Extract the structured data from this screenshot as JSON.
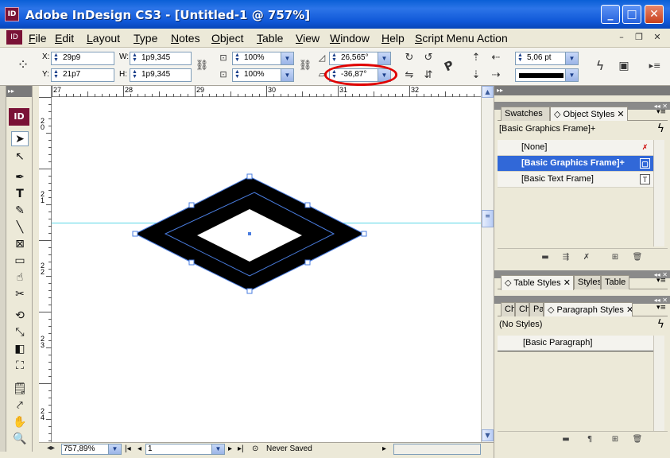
{
  "titlebar": {
    "title": "Adobe InDesign CS3 - [Untitled-1 @ 757%]",
    "app_icon": "ID"
  },
  "menu": [
    "File",
    "Edit",
    "Layout",
    "Type",
    "Notes",
    "Object",
    "Table",
    "View",
    "Window",
    "Help",
    "Script Menu Action"
  ],
  "control": {
    "x_label": "X:",
    "x_value": "29p9",
    "y_label": "Y:",
    "y_value": "21p7",
    "w_label": "W:",
    "w_value": "1p9,345",
    "h_label": "H:",
    "h_value": "1p9,345",
    "scale_x": "100%",
    "scale_y": "100%",
    "rotation": "26,565°",
    "shear": "-36,87°",
    "stroke_weight": "5,06 pt",
    "p_label": "P",
    "highlight_color": "#e00000"
  },
  "ruler": {
    "h_ticks": [
      "27",
      "28",
      "29",
      "30",
      "31",
      "32"
    ],
    "v_ticks": [
      "2\n0",
      "2\n1",
      "2\n2",
      "2\n3",
      "2\n4"
    ]
  },
  "toolbox": {
    "logo": "ID"
  },
  "status": {
    "zoom": "757,89%",
    "page": "1",
    "save_state": "Never Saved"
  },
  "panels": {
    "object_styles": {
      "tabs": [
        "Swatches",
        "Object Styles"
      ],
      "current": "[Basic Graphics Frame]+",
      "items": [
        "[None]",
        "[Basic Graphics Frame]+",
        "[Basic Text Frame]"
      ]
    },
    "table_styles": {
      "tabs": [
        "Table Styles",
        "Styles",
        "Table"
      ]
    },
    "paragraph_styles": {
      "tabs": [
        "Ch",
        "Ch",
        "Pa",
        "Paragraph Styles"
      ],
      "current": "(No Styles)",
      "items": [
        "[Basic Paragraph]"
      ]
    }
  },
  "colors": {
    "guide": "#5ad6e6",
    "frame_edge": "#4a7de0",
    "titlebar": "#0a5fd6",
    "selection": "#3168d8"
  }
}
